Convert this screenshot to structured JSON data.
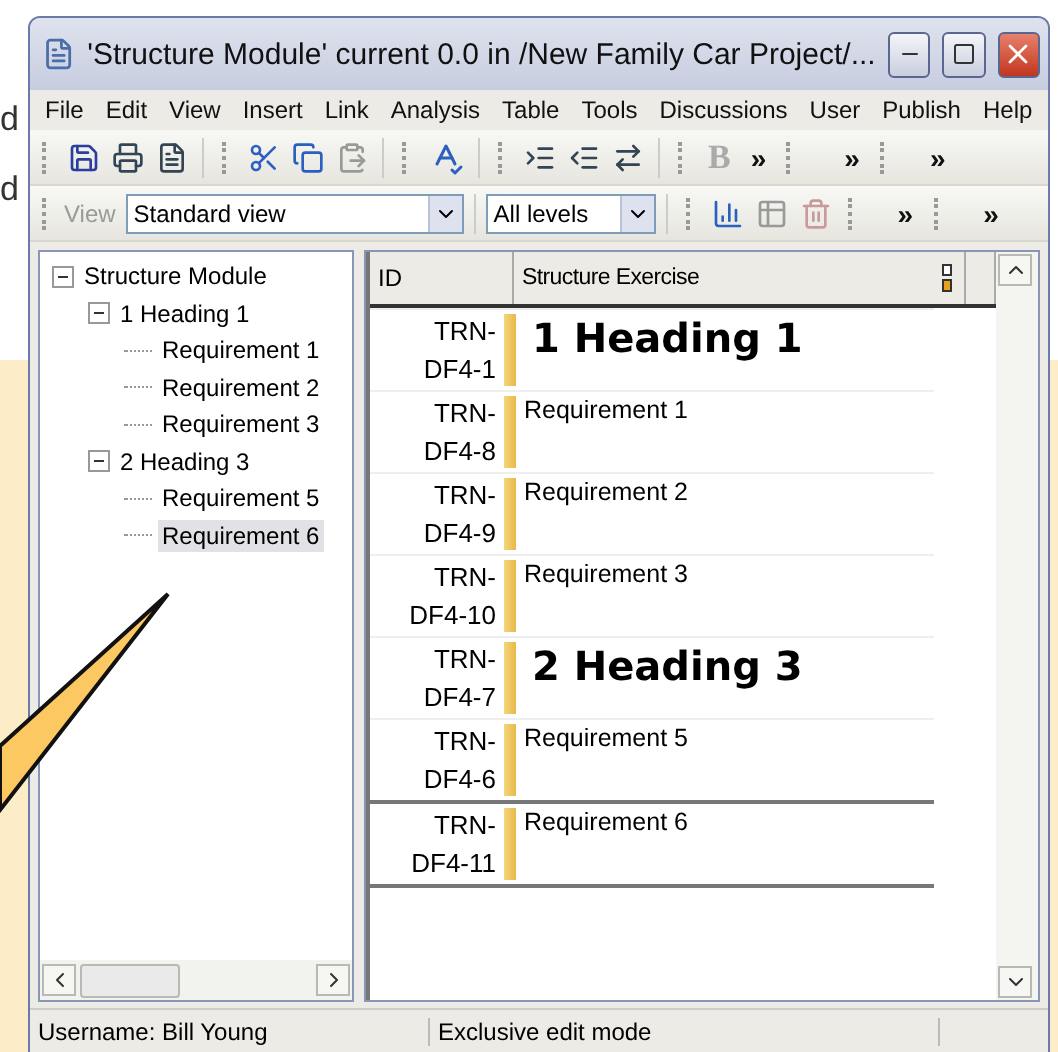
{
  "background_texts": [
    "d",
    "d"
  ],
  "window": {
    "title": "'Structure Module' current 0.0 in /New Family Car Project/..."
  },
  "menu": [
    "File",
    "Edit",
    "View",
    "Insert",
    "Link",
    "Analysis",
    "Table",
    "Tools",
    "Discussions",
    "User",
    "Publish",
    "Help"
  ],
  "toolbar": {
    "bold": "B",
    "overflow": [
      "»",
      "»",
      "»"
    ]
  },
  "view_bar": {
    "label": "View",
    "view_select": "Standard view",
    "level_select": "All levels",
    "overflow": [
      "»",
      "»"
    ]
  },
  "tree": {
    "label": "Structure Module",
    "expanded": true,
    "selected": false,
    "children": [
      {
        "label": "1 Heading 1",
        "expanded": true,
        "selected": false,
        "children": [
          {
            "label": "Requirement 1",
            "selected": false
          },
          {
            "label": "Requirement 2",
            "selected": false
          },
          {
            "label": "Requirement 3",
            "selected": false
          }
        ]
      },
      {
        "label": "2 Heading 3",
        "expanded": true,
        "selected": false,
        "children": [
          {
            "label": "Requirement 5",
            "selected": false
          },
          {
            "label": "Requirement 6",
            "selected": true
          }
        ]
      }
    ]
  },
  "table": {
    "columns": [
      "ID",
      "Structure Exercise"
    ],
    "rows": [
      {
        "id": "TRN-DF4-1",
        "text": "1 Heading 1",
        "kind": "heading",
        "selected": false
      },
      {
        "id": "TRN-DF4-8",
        "text": "Requirement 1",
        "kind": "requirement",
        "selected": false
      },
      {
        "id": "TRN-DF4-9",
        "text": "Requirement 2",
        "kind": "requirement",
        "selected": false
      },
      {
        "id": "TRN-DF4-10",
        "text": "Requirement 3",
        "kind": "requirement",
        "selected": false
      },
      {
        "id": "TRN-DF4-7",
        "text": "2 Heading 3",
        "kind": "heading",
        "selected": false
      },
      {
        "id": "TRN-DF4-6",
        "text": "Requirement 5",
        "kind": "requirement",
        "selected": false
      },
      {
        "id": "TRN-DF4-11",
        "text": "Requirement 6",
        "kind": "requirement",
        "selected": true
      }
    ]
  },
  "status_bar": [
    "Username: Bill Young",
    "Exclusive edit mode"
  ]
}
